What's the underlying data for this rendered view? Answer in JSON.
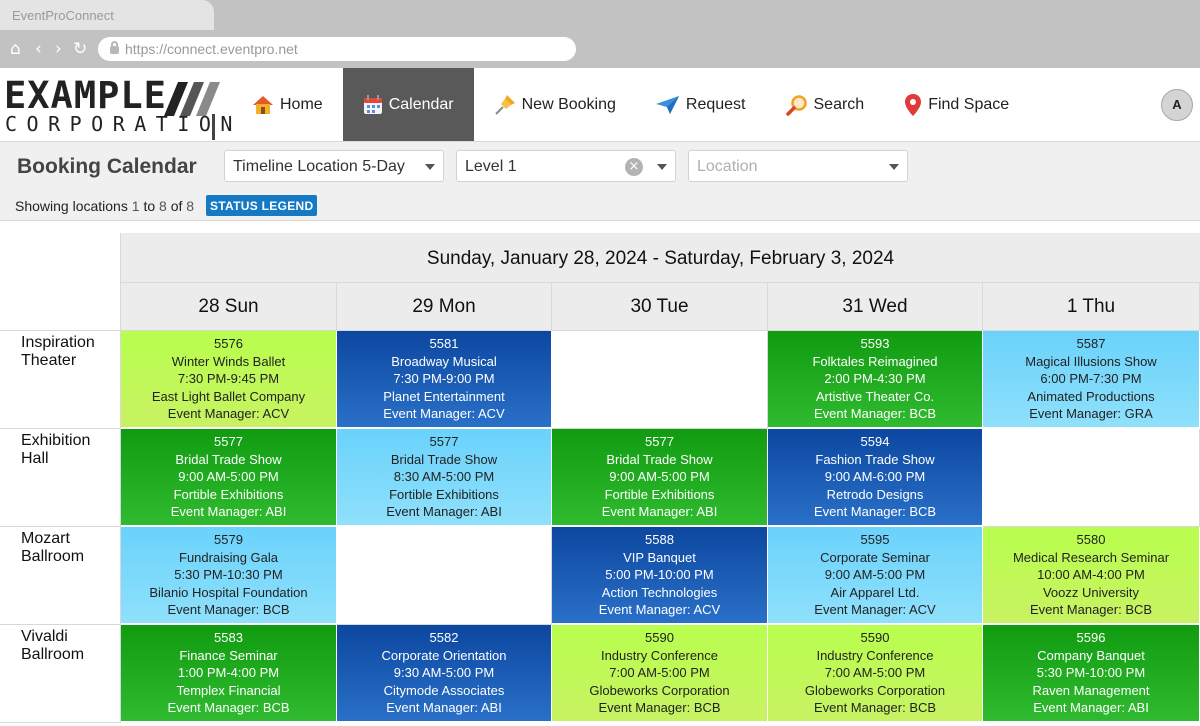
{
  "browser": {
    "tab_title": "EventProConnect",
    "url": "https://connect.eventpro.net"
  },
  "logo": {
    "line1": "EXAMPLE",
    "line2": "CORPORATION"
  },
  "nav": {
    "items": [
      {
        "label": "Home",
        "icon": "home-icon"
      },
      {
        "label": "Calendar",
        "icon": "calendar-icon"
      },
      {
        "label": "New Booking",
        "icon": "pushpin-icon"
      },
      {
        "label": "Request",
        "icon": "paper-plane-icon"
      },
      {
        "label": "Search",
        "icon": "magnifier-icon"
      },
      {
        "label": "Find Space",
        "icon": "map-pin-icon"
      }
    ],
    "active": "Calendar",
    "avatar_initial": "A"
  },
  "toolbar": {
    "title": "Booking Calendar",
    "view_select": "Timeline Location 5-Day",
    "level_select": "Level 1",
    "location_placeholder": "Location",
    "showing_prefix": "Showing locations",
    "showing_from": "1",
    "showing_to_word": "to",
    "showing_to": "8",
    "showing_of_word": "of",
    "showing_total": "8",
    "legend_button": "STATUS LEGEND"
  },
  "colors": {
    "green": "#1aa81a",
    "lime": "#bff75a",
    "navy": "#1656b0",
    "sky": "#7cdafb",
    "active_nav": "#595959",
    "legend_button": "#1579c4"
  },
  "calendar": {
    "range": "Sunday, January 28, 2024 - Saturday, February 3, 2024",
    "days": [
      "28 Sun",
      "29 Mon",
      "30 Tue",
      "31 Wed",
      "1 Thu"
    ],
    "rows": [
      {
        "location": "Inspiration Theater",
        "cells": [
          {
            "status": "lime",
            "id": "5576",
            "event": "Winter Winds Ballet",
            "time": "7:30 PM-9:45 PM",
            "client": "East Light Ballet Company",
            "manager": "Event Manager: ACV"
          },
          {
            "status": "navy",
            "id": "5581",
            "event": "Broadway Musical",
            "time": "7:30 PM-9:00 PM",
            "client": "Planet Entertainment",
            "manager": "Event Manager: ACV"
          },
          {
            "status": "empty"
          },
          {
            "status": "green",
            "id": "5593",
            "event": "Folktales Reimagined",
            "time": "2:00 PM-4:30 PM",
            "client": "Artistive Theater Co.",
            "manager": "Event Manager: BCB"
          },
          {
            "status": "sky",
            "id": "5587",
            "event": "Magical Illusions Show",
            "time": "6:00 PM-7:30 PM",
            "client": "Animated Productions",
            "manager": "Event Manager: GRA"
          }
        ]
      },
      {
        "location": "Exhibition Hall",
        "cells": [
          {
            "status": "green",
            "id": "5577",
            "event": "Bridal Trade Show",
            "time": "9:00 AM-5:00 PM",
            "client": "Fortible Exhibitions",
            "manager": "Event Manager: ABI"
          },
          {
            "status": "sky",
            "id": "5577",
            "event": "Bridal Trade Show",
            "time": "8:30 AM-5:00 PM",
            "client": "Fortible Exhibitions",
            "manager": "Event Manager: ABI"
          },
          {
            "status": "green",
            "id": "5577",
            "event": "Bridal Trade Show",
            "time": "9:00 AM-5:00 PM",
            "client": "Fortible Exhibitions",
            "manager": "Event Manager: ABI"
          },
          {
            "status": "navy",
            "id": "5594",
            "event": "Fashion Trade Show",
            "time": "9:00 AM-6:00 PM",
            "client": "Retrodo Designs",
            "manager": "Event Manager: BCB"
          },
          {
            "status": "empty"
          }
        ]
      },
      {
        "location": "Mozart Ballroom",
        "cells": [
          {
            "status": "sky",
            "id": "5579",
            "event": "Fundraising Gala",
            "time": "5:30 PM-10:30 PM",
            "client": "Bilanio Hospital Foundation",
            "manager": "Event Manager: BCB"
          },
          {
            "status": "empty"
          },
          {
            "status": "navy",
            "id": "5588",
            "event": "VIP Banquet",
            "time": "5:00 PM-10:00 PM",
            "client": "Action Technologies",
            "manager": "Event Manager: ACV"
          },
          {
            "status": "sky",
            "id": "5595",
            "event": "Corporate Seminar",
            "time": "9:00 AM-5:00 PM",
            "client": "Air Apparel Ltd.",
            "manager": "Event Manager: ACV"
          },
          {
            "status": "lime",
            "id": "5580",
            "event": "Medical Research Seminar",
            "time": "10:00 AM-4:00 PM",
            "client": "Voozz University",
            "manager": "Event Manager: BCB"
          }
        ]
      },
      {
        "location": "Vivaldi Ballroom",
        "cells": [
          {
            "status": "green",
            "id": "5583",
            "event": "Finance Seminar",
            "time": "1:00 PM-4:00 PM",
            "client": "Templex Financial",
            "manager": "Event Manager: BCB"
          },
          {
            "status": "navy",
            "id": "5582",
            "event": "Corporate Orientation",
            "time": "9:30 AM-5:00 PM",
            "client": "Citymode Associates",
            "manager": "Event Manager: ABI"
          },
          {
            "status": "lime",
            "id": "5590",
            "event": "Industry Conference",
            "time": "7:00 AM-5:00 PM",
            "client": "Globeworks Corporation",
            "manager": "Event Manager: BCB"
          },
          {
            "status": "lime",
            "id": "5590",
            "event": "Industry Conference",
            "time": "7:00 AM-5:00 PM",
            "client": "Globeworks Corporation",
            "manager": "Event Manager: BCB"
          },
          {
            "status": "green",
            "id": "5596",
            "event": "Company Banquet",
            "time": "5:30 PM-10:00 PM",
            "client": "Raven Management",
            "manager": "Event Manager: ABI"
          }
        ]
      }
    ]
  }
}
